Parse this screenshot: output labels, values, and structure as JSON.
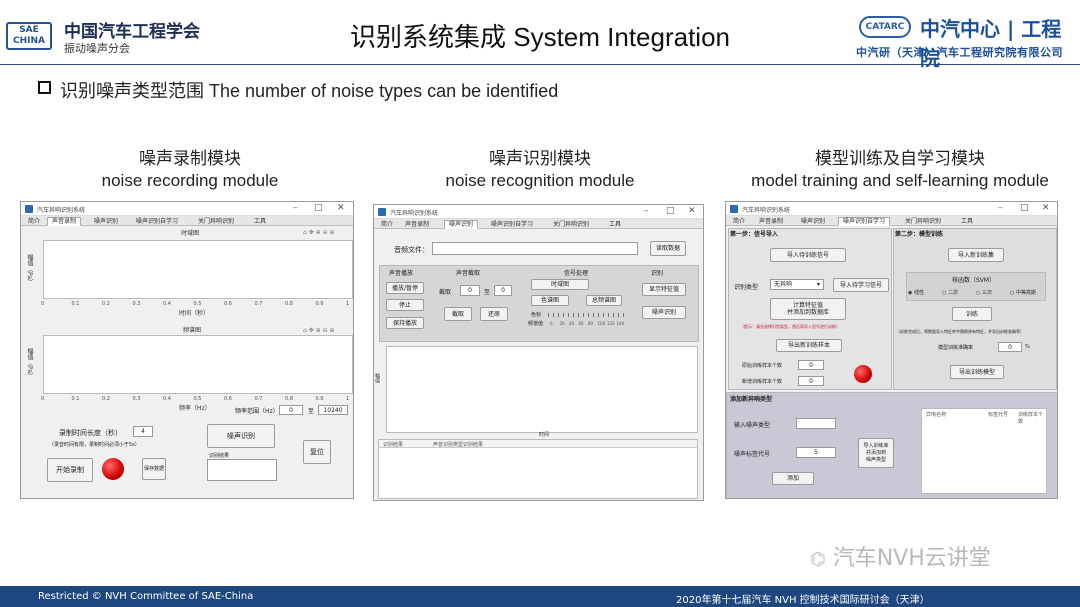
{
  "header": {
    "sae_logo": "SAE CHINA",
    "org_name": "中国汽车工程学会",
    "org_sub": "振动噪声分会",
    "title": "识别系统集成 System Integration",
    "catarc_logo": "CATARC",
    "catarc_name": "中汽中心 | 工程院",
    "catarc_sub": "中汽研（天津）汽车工程研究院有限公司"
  },
  "section": "识别噪声类型范围 The number of noise types can be identified",
  "modules": [
    {
      "cn": "噪声录制模块",
      "en": "noise recording module"
    },
    {
      "cn": "噪声识别模块",
      "en": "noise recognition module"
    },
    {
      "cn": "模型训练及自学习模块",
      "en": "model training and self-learning module"
    }
  ],
  "win1": {
    "title": "汽车异响识别系统",
    "tabs": [
      "简介",
      "声音录制",
      "噪声识别",
      "噪声识别自学习",
      "关门异响识别",
      "工具"
    ],
    "plot1_title": "时域图",
    "plot1_xlabel": "时间（秒）",
    "plot1_ylabel": "幅值（Pa）",
    "plot2_title": "频谱图",
    "plot2_xlabel": "频率（Hz）",
    "plot2_ylabel": "幅值（Pa）",
    "xticks": [
      "0",
      "0.1",
      "0.2",
      "0.3",
      "0.4",
      "0.5",
      "0.6",
      "0.7",
      "0.8",
      "0.9",
      "1"
    ],
    "freq_range_label": "频率范围（Hz）",
    "freq_from": "0",
    "freq_to_label": "至",
    "freq_to": "10240",
    "record_len_label": "录制时间长度（秒）",
    "record_len": "4",
    "record_hint": "（录音时间有限，录制时间必须小于5s）",
    "start_btn": "开始录制",
    "save_btn": "保存数据",
    "identify_btn": "噪声识别",
    "result_label": "识别结果",
    "reset_btn": "复位"
  },
  "win2": {
    "title": "汽车异响识别系统",
    "tabs": [
      "简介",
      "声音录制",
      "噪声识别",
      "噪声识别自学习",
      "关门异响识别",
      "工具"
    ],
    "file_label": "音频文件：",
    "read_btn": "读取数据",
    "g1_title": "声音播放",
    "g1_btns": [
      "播放/暂停",
      "停止",
      "保持播放"
    ],
    "g2_title": "声音截取",
    "g2_from_label": "截取",
    "g2_from": "0",
    "g2_to_label": "至",
    "g2_to": "0",
    "g2_btns": [
      "截取",
      "还原"
    ],
    "g3_title": "信号处理",
    "g3_btns": [
      "时域图",
      "色谱图",
      "总频谱图"
    ],
    "g3_scale_label": "色标",
    "g3_ticks": [
      "0",
      "20",
      "40",
      "60",
      "80",
      "100",
      "120",
      "140"
    ],
    "g3_resolution_label": "频谱值",
    "g4_title": "识别",
    "g4_btns": [
      "显示特征值",
      "噪声识别"
    ],
    "plot_xlabel": "时间",
    "plot_ylabel": "幅值",
    "table_cols": [
      "识别结果",
      "声音识别类型识别结果"
    ]
  },
  "win3": {
    "title": "汽车异响识别系统",
    "tabs": [
      "简介",
      "声音录制",
      "噪声识别",
      "噪声识别自学习",
      "关门异响识别",
      "工具"
    ],
    "step1": "第一步：信号导入",
    "import_btn": "导入待训练信号",
    "type_label": "识别类型",
    "type_value": "无异响",
    "import_sample_btn": "导入待学习信号",
    "calc_btn": "计算特征值\n并添加到数据库",
    "warn": "（提示：请先选择识别类型，然后再导入信号进行训练）",
    "export_btn": "导出新训练样本",
    "count1_label": "原始训练样本个数",
    "count1": "0",
    "count2_label": "新增训练样本个数",
    "count2": "0",
    "step2": "第二步：模型训练",
    "import_model_btn": "导入新训练集",
    "svm_label": "核函数（SVM）",
    "svm_opts": [
      "线性",
      "二次",
      "三次",
      "中等高斯"
    ],
    "train_btn": "训练",
    "train_hint": "（训练完成后，将数据导入特征库中替换原有特征，并导出训练准确率）",
    "acc_label": "模型训练准确率",
    "acc": "0",
    "acc_unit": "%",
    "export_model_btn": "导出训练模型",
    "add_header": "添加新异响类型",
    "noise_type_label": "输入噪声类型",
    "code_label": "噪声标签代号",
    "code_value": "5",
    "side_btn": "导入训练库\n并添加到\n噪声类型",
    "add_btn": "添加",
    "list_cols": [
      "异响名称",
      "标签代号",
      "训练样本个数"
    ]
  },
  "watermark": "汽车NVH云讲堂",
  "footer": {
    "left": "Restricted © NVH Committee of SAE-China",
    "right": "2020年第十七届汽车 NVH 控制技术国际研讨会（天津）"
  }
}
